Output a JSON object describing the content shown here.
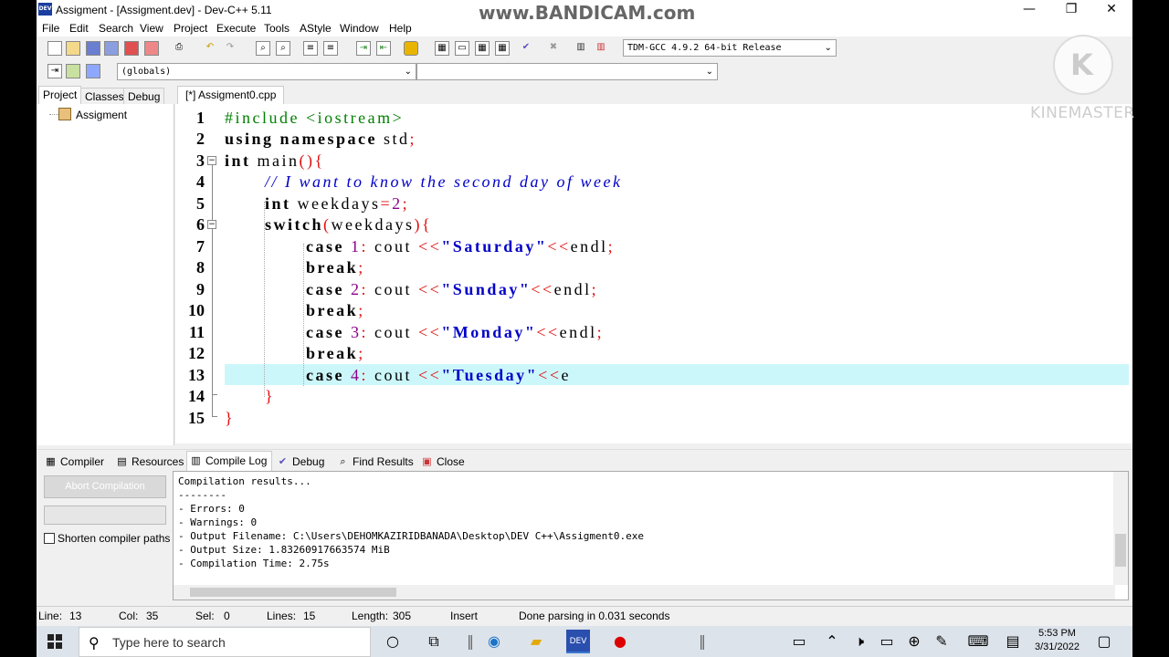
{
  "window": {
    "title": "Assigment - [Assigment.dev] - Dev-C++ 5.11",
    "minimize": "—",
    "maximize": "❐",
    "close": "✕",
    "app_icon": "DEV"
  },
  "watermark": "www.BANDICAM.com",
  "overlay": {
    "brand": "KINEMASTER",
    "logo_letter": "K"
  },
  "menu": [
    "File",
    "Edit",
    "Search",
    "View",
    "Project",
    "Execute",
    "Tools",
    "AStyle",
    "Window",
    "Help"
  ],
  "toolbar": {
    "compiler_select": "TDM-GCC 4.9.2 64-bit Release",
    "scope_select": "(globals)",
    "function_select": ""
  },
  "left_panel": {
    "tabs": [
      "Project",
      "Classes",
      "Debug"
    ],
    "tree_root": "Assigment"
  },
  "editor": {
    "tab": "[*] Assigment0.cpp",
    "current_line": 13,
    "lines": [
      {
        "n": "1"
      },
      {
        "n": "2"
      },
      {
        "n": "3"
      },
      {
        "n": "4"
      },
      {
        "n": "5"
      },
      {
        "n": "6"
      },
      {
        "n": "7"
      },
      {
        "n": "8"
      },
      {
        "n": "9"
      },
      {
        "n": "10"
      },
      {
        "n": "11"
      },
      {
        "n": "12"
      },
      {
        "n": "13"
      },
      {
        "n": "14"
      },
      {
        "n": "15"
      }
    ],
    "code": {
      "l1": "#include <iostream>",
      "l2_kw1": "using",
      "l2_kw2": "namespace",
      "l2_id": "std",
      "l3_kw": "int",
      "l3_id": "main",
      "l4": "// I want to know the second day of week",
      "l5_kw": "int",
      "l5_id": "weekdays",
      "l5_num": "2",
      "l6_kw": "switch",
      "l6_id": "weekdays",
      "case_kw": "case",
      "break_kw": "break",
      "cout": "cout",
      "endl": "endl",
      "c1_num": "1",
      "c1_str": "\"Saturday\"",
      "c2_num": "2",
      "c2_str": "\"Sunday\"",
      "c3_num": "3",
      "c3_str": "\"Monday\"",
      "c4_num": "4",
      "c4_str": "\"Tuesday\"",
      "c4_tail": "e"
    }
  },
  "bottom_panel": {
    "tabs": [
      "Compiler",
      "Resources",
      "Compile Log",
      "Debug",
      "Find Results",
      "Close"
    ],
    "active_tab": "Compile Log",
    "abort_button": "Abort Compilation",
    "shorten_label": "Shorten compiler paths",
    "log": [
      "Compilation results...",
      "--------",
      "- Errors: 0",
      "- Warnings: 0",
      "- Output Filename: C:\\Users\\DEHOMKAZIRIDBANADA\\Desktop\\DEV C++\\Assigment0.exe",
      "- Output Size: 1.83260917663574 MiB",
      "- Compilation Time: 2.75s"
    ]
  },
  "status": {
    "line_label": "Line:",
    "line": "13",
    "col_label": "Col:",
    "col": "35",
    "sel_label": "Sel:",
    "sel": "0",
    "lines_label": "Lines:",
    "lines": "15",
    "length_label": "Length:",
    "length": "305",
    "mode": "Insert",
    "message": "Done parsing in 0.031 seconds"
  },
  "taskbar": {
    "search_placeholder": "Type here to search",
    "time": "5:53 PM",
    "date": "3/31/2022"
  }
}
